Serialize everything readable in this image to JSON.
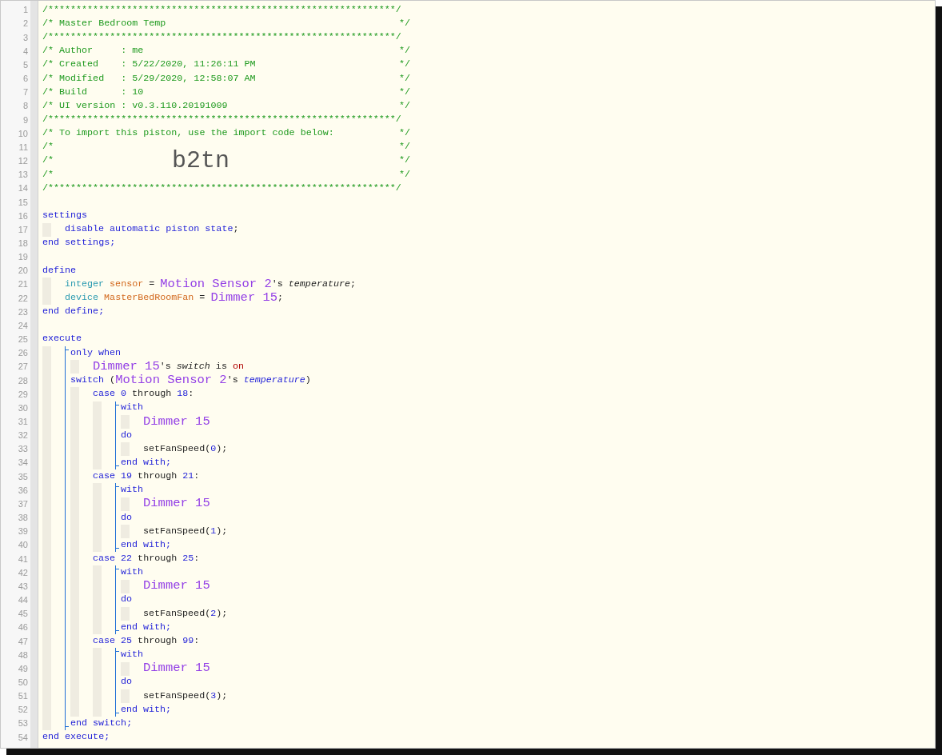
{
  "code_lines": [
    {
      "kind": "line",
      "n": "1",
      "tokens": [
        {
          "kind": "comment",
          "text": "/**************************************************************/"
        }
      ]
    },
    {
      "kind": "line",
      "n": "2",
      "tokens": [
        {
          "kind": "comment",
          "text": "/* Master Bedroom Temp"
        }
      ],
      "end": "*/"
    },
    {
      "kind": "line",
      "n": "3",
      "tokens": [
        {
          "kind": "comment",
          "text": "/**************************************************************/"
        }
      ]
    },
    {
      "kind": "line",
      "n": "4",
      "tokens": [
        {
          "kind": "comment",
          "text": "/* Author     : me"
        }
      ],
      "end": "*/"
    },
    {
      "kind": "line",
      "n": "5",
      "tokens": [
        {
          "kind": "comment",
          "text": "/* Created    : 5/22/2020, 11:26:11 PM"
        }
      ],
      "end": "*/"
    },
    {
      "kind": "line",
      "n": "6",
      "tokens": [
        {
          "kind": "comment",
          "text": "/* Modified   : 5/29/2020, 12:58:07 AM"
        }
      ],
      "end": "*/"
    },
    {
      "kind": "line",
      "n": "7",
      "tokens": [
        {
          "kind": "comment",
          "text": "/* Build      : 10"
        }
      ],
      "end": "*/"
    },
    {
      "kind": "line",
      "n": "8",
      "tokens": [
        {
          "kind": "comment",
          "text": "/* UI version : v0.3.110.20191009"
        }
      ],
      "end": "*/"
    },
    {
      "kind": "line",
      "n": "9",
      "tokens": [
        {
          "kind": "comment",
          "text": "/**************************************************************/"
        }
      ]
    },
    {
      "kind": "line",
      "n": "10",
      "tokens": [
        {
          "kind": "comment",
          "text": "/* To import this piston, use the import code below:"
        }
      ],
      "end": "*/"
    },
    {
      "kind": "line",
      "n": "11",
      "tokens": [
        {
          "kind": "comment",
          "text": "/*"
        }
      ],
      "end": "*/"
    },
    {
      "kind": "line",
      "n": "12",
      "tokens": [
        {
          "kind": "comment",
          "text": "/*"
        },
        {
          "kind": "code",
          "text": "b2tn"
        }
      ],
      "end": "*/"
    },
    {
      "kind": "line",
      "n": "13",
      "tokens": [
        {
          "kind": "comment",
          "text": "/*"
        }
      ],
      "end": "*/"
    },
    {
      "kind": "line",
      "n": "14",
      "tokens": [
        {
          "kind": "comment",
          "text": "/**************************************************************/"
        }
      ]
    },
    {
      "kind": "line",
      "n": "15"
    },
    {
      "kind": "line",
      "n": "16",
      "tokens": [
        {
          "kind": "kw",
          "text": "settings"
        }
      ],
      "children": [
        {
          "kind": "line",
          "n": "17",
          "tokens": [
            {
              "kind": "kw",
              "text": "disable automatic piston state"
            },
            {
              "kind": "plain",
              "text": ";"
            }
          ]
        }
      ]
    },
    {
      "kind": "line",
      "n": "18",
      "tokens": [
        {
          "kind": "kw",
          "text": "end settings;"
        }
      ]
    },
    {
      "kind": "line",
      "n": "19"
    },
    {
      "kind": "line",
      "n": "20",
      "tokens": [
        {
          "kind": "kw",
          "text": "define"
        }
      ],
      "children": [
        {
          "kind": "line",
          "n": "21",
          "tokens": [
            {
              "kind": "type",
              "text": "integer "
            },
            {
              "kind": "var",
              "text": "sensor"
            },
            {
              "kind": "plain",
              "text": " = "
            },
            {
              "kind": "device",
              "text": "Motion Sensor 2"
            },
            {
              "kind": "plain",
              "text": "'s "
            },
            {
              "kind": "attr",
              "text": "temperature"
            },
            {
              "kind": "plain",
              "text": ";"
            }
          ]
        },
        {
          "kind": "line",
          "n": "22",
          "tokens": [
            {
              "kind": "type",
              "text": "device "
            },
            {
              "kind": "var",
              "text": "MasterBedRoomFan"
            },
            {
              "kind": "plain",
              "text": " = "
            },
            {
              "kind": "device",
              "text": "Dimmer 15"
            },
            {
              "kind": "plain",
              "text": ";"
            }
          ]
        }
      ]
    },
    {
      "kind": "line",
      "n": "23",
      "tokens": [
        {
          "kind": "kw",
          "text": "end define;"
        }
      ]
    },
    {
      "kind": "line",
      "n": "24"
    },
    {
      "kind": "line",
      "n": "25",
      "tokens": [
        {
          "kind": "kw",
          "text": "execute"
        }
      ],
      "children": [
        {
          "kind": "bracket",
          "children": [
            {
              "kind": "line",
              "n": "26",
              "tokens": [
                {
                  "kind": "kw",
                  "text": "only when"
                }
              ],
              "children": [
                {
                  "kind": "line",
                  "n": "27",
                  "tokens": [
                    {
                      "kind": "device",
                      "text": "Dimmer 15"
                    },
                    {
                      "kind": "plain",
                      "text": "'s "
                    },
                    {
                      "kind": "attr",
                      "text": "switch"
                    },
                    {
                      "kind": "plain",
                      "text": " is "
                    },
                    {
                      "kind": "value",
                      "text": "on"
                    }
                  ]
                }
              ]
            },
            {
              "kind": "line",
              "n": "28",
              "tokens": [
                {
                  "kind": "kw",
                  "text": "switch"
                },
                {
                  "kind": "plain",
                  "text": " ("
                },
                {
                  "kind": "device",
                  "text": "Motion Sensor 2"
                },
                {
                  "kind": "plain",
                  "text": "'s "
                },
                {
                  "kind": "attr_kw",
                  "text": "temperature"
                },
                {
                  "kind": "plain",
                  "text": ")"
                }
              ],
              "children": [
                {
                  "kind": "line",
                  "n": "29",
                  "tokens": [
                    {
                      "kind": "kw",
                      "text": "case "
                    },
                    {
                      "kind": "num",
                      "text": "0"
                    },
                    {
                      "kind": "plain",
                      "text": " through "
                    },
                    {
                      "kind": "num",
                      "text": "18"
                    },
                    {
                      "kind": "plain",
                      "text": ":"
                    }
                  ],
                  "children": [
                    {
                      "kind": "bracket",
                      "children": [
                        {
                          "kind": "line",
                          "n": "30",
                          "tokens": [
                            {
                              "kind": "kw",
                              "text": "with"
                            }
                          ],
                          "children": [
                            {
                              "kind": "line",
                              "n": "31",
                              "tokens": [
                                {
                                  "kind": "device",
                                  "text": "Dimmer 15"
                                }
                              ]
                            }
                          ]
                        },
                        {
                          "kind": "line",
                          "n": "32",
                          "tokens": [
                            {
                              "kind": "kw",
                              "text": "do"
                            }
                          ],
                          "children": [
                            {
                              "kind": "line",
                              "n": "33",
                              "tokens": [
                                {
                                  "kind": "plain",
                                  "text": "setFanSpeed("
                                },
                                {
                                  "kind": "num",
                                  "text": "0"
                                },
                                {
                                  "kind": "plain",
                                  "text": ");"
                                }
                              ]
                            }
                          ]
                        },
                        {
                          "kind": "line",
                          "n": "34",
                          "tokens": [
                            {
                              "kind": "kw",
                              "text": "end with;"
                            }
                          ]
                        }
                      ]
                    }
                  ]
                },
                {
                  "kind": "line",
                  "n": "35",
                  "tokens": [
                    {
                      "kind": "kw",
                      "text": "case "
                    },
                    {
                      "kind": "num",
                      "text": "19"
                    },
                    {
                      "kind": "plain",
                      "text": " through "
                    },
                    {
                      "kind": "num",
                      "text": "21"
                    },
                    {
                      "kind": "plain",
                      "text": ":"
                    }
                  ],
                  "children": [
                    {
                      "kind": "bracket",
                      "children": [
                        {
                          "kind": "line",
                          "n": "36",
                          "tokens": [
                            {
                              "kind": "kw",
                              "text": "with"
                            }
                          ],
                          "children": [
                            {
                              "kind": "line",
                              "n": "37",
                              "tokens": [
                                {
                                  "kind": "device",
                                  "text": "Dimmer 15"
                                }
                              ]
                            }
                          ]
                        },
                        {
                          "kind": "line",
                          "n": "38",
                          "tokens": [
                            {
                              "kind": "kw",
                              "text": "do"
                            }
                          ],
                          "children": [
                            {
                              "kind": "line",
                              "n": "39",
                              "tokens": [
                                {
                                  "kind": "plain",
                                  "text": "setFanSpeed("
                                },
                                {
                                  "kind": "num",
                                  "text": "1"
                                },
                                {
                                  "kind": "plain",
                                  "text": ");"
                                }
                              ]
                            }
                          ]
                        },
                        {
                          "kind": "line",
                          "n": "40",
                          "tokens": [
                            {
                              "kind": "kw",
                              "text": "end with;"
                            }
                          ]
                        }
                      ]
                    }
                  ]
                },
                {
                  "kind": "line",
                  "n": "41",
                  "tokens": [
                    {
                      "kind": "kw",
                      "text": "case "
                    },
                    {
                      "kind": "num",
                      "text": "22"
                    },
                    {
                      "kind": "plain",
                      "text": " through "
                    },
                    {
                      "kind": "num",
                      "text": "25"
                    },
                    {
                      "kind": "plain",
                      "text": ":"
                    }
                  ],
                  "children": [
                    {
                      "kind": "bracket",
                      "children": [
                        {
                          "kind": "line",
                          "n": "42",
                          "tokens": [
                            {
                              "kind": "kw",
                              "text": "with"
                            }
                          ],
                          "children": [
                            {
                              "kind": "line",
                              "n": "43",
                              "tokens": [
                                {
                                  "kind": "device",
                                  "text": "Dimmer 15"
                                }
                              ]
                            }
                          ]
                        },
                        {
                          "kind": "line",
                          "n": "44",
                          "tokens": [
                            {
                              "kind": "kw",
                              "text": "do"
                            }
                          ],
                          "children": [
                            {
                              "kind": "line",
                              "n": "45",
                              "tokens": [
                                {
                                  "kind": "plain",
                                  "text": "setFanSpeed("
                                },
                                {
                                  "kind": "num",
                                  "text": "2"
                                },
                                {
                                  "kind": "plain",
                                  "text": ");"
                                }
                              ]
                            }
                          ]
                        },
                        {
                          "kind": "line",
                          "n": "46",
                          "tokens": [
                            {
                              "kind": "kw",
                              "text": "end with;"
                            }
                          ]
                        }
                      ]
                    }
                  ]
                },
                {
                  "kind": "line",
                  "n": "47",
                  "tokens": [
                    {
                      "kind": "kw",
                      "text": "case "
                    },
                    {
                      "kind": "num",
                      "text": "25"
                    },
                    {
                      "kind": "plain",
                      "text": " through "
                    },
                    {
                      "kind": "num",
                      "text": "99"
                    },
                    {
                      "kind": "plain",
                      "text": ":"
                    }
                  ],
                  "children": [
                    {
                      "kind": "bracket",
                      "children": [
                        {
                          "kind": "line",
                          "n": "48",
                          "tokens": [
                            {
                              "kind": "kw",
                              "text": "with"
                            }
                          ],
                          "children": [
                            {
                              "kind": "line",
                              "n": "49",
                              "tokens": [
                                {
                                  "kind": "device",
                                  "text": "Dimmer 15"
                                }
                              ]
                            }
                          ]
                        },
                        {
                          "kind": "line",
                          "n": "50",
                          "tokens": [
                            {
                              "kind": "kw",
                              "text": "do"
                            }
                          ],
                          "children": [
                            {
                              "kind": "line",
                              "n": "51",
                              "tokens": [
                                {
                                  "kind": "plain",
                                  "text": "setFanSpeed("
                                },
                                {
                                  "kind": "num",
                                  "text": "3"
                                },
                                {
                                  "kind": "plain",
                                  "text": ");"
                                }
                              ]
                            }
                          ]
                        },
                        {
                          "kind": "line",
                          "n": "52",
                          "tokens": [
                            {
                              "kind": "kw",
                              "text": "end with;"
                            }
                          ]
                        }
                      ]
                    }
                  ]
                }
              ]
            },
            {
              "kind": "line",
              "n": "53",
              "tokens": [
                {
                  "kind": "kw",
                  "text": "end switch;"
                }
              ]
            }
          ]
        }
      ]
    },
    {
      "kind": "line",
      "n": "54",
      "tokens": [
        {
          "kind": "kw",
          "text": "end execute;"
        }
      ]
    }
  ]
}
